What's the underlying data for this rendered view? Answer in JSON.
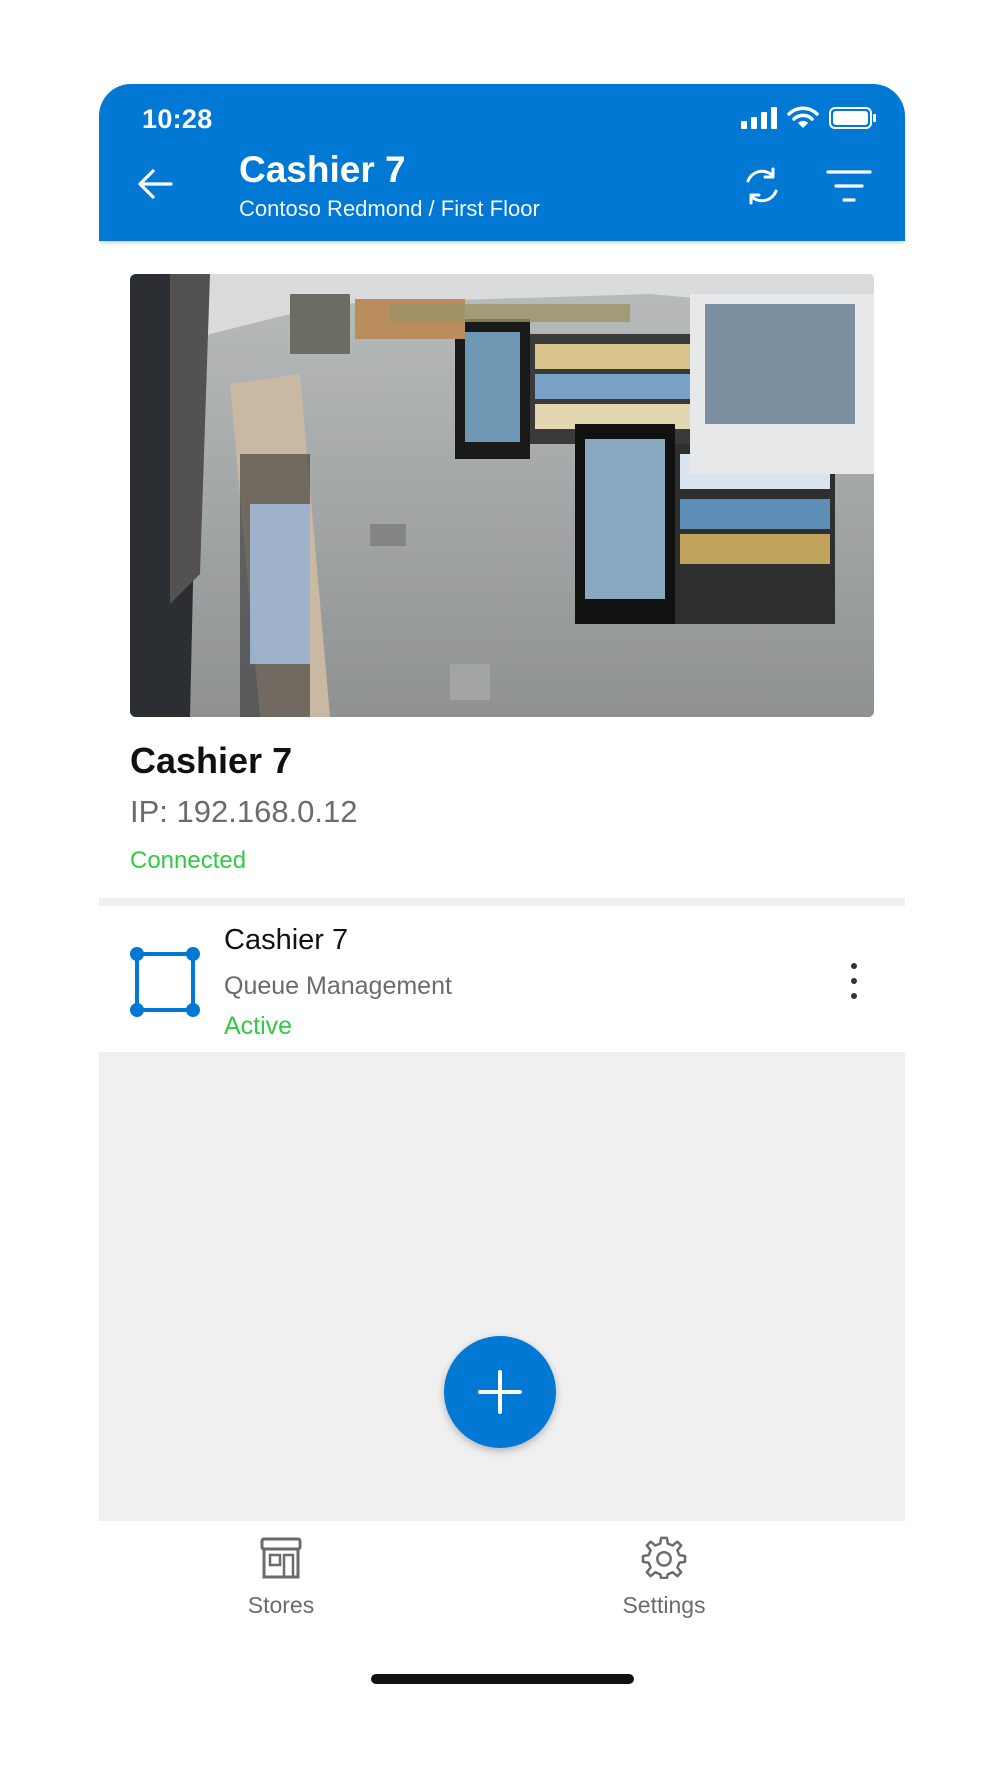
{
  "status_bar": {
    "time": "10:28"
  },
  "header": {
    "title": "Cashier 7",
    "subtitle": "Contoso Redmond / First Floor",
    "back_icon": "arrow-left-icon",
    "sync_icon": "sync-icon",
    "filter_icon": "filter-icon",
    "accent_color": "#0078d4"
  },
  "camera": {
    "name": "Cashier 7",
    "ip": "IP: 192.168.0.12",
    "status": "Connected",
    "status_color": "#2ecc40"
  },
  "skills": [
    {
      "title": "Cashier 7",
      "type": "Queue Management",
      "status": "Active",
      "icon": "zone-polygon-icon"
    }
  ],
  "nav": {
    "tabs": [
      {
        "label": "Stores",
        "icon": "store-icon"
      },
      {
        "label": "Settings",
        "icon": "gear-icon"
      }
    ]
  }
}
